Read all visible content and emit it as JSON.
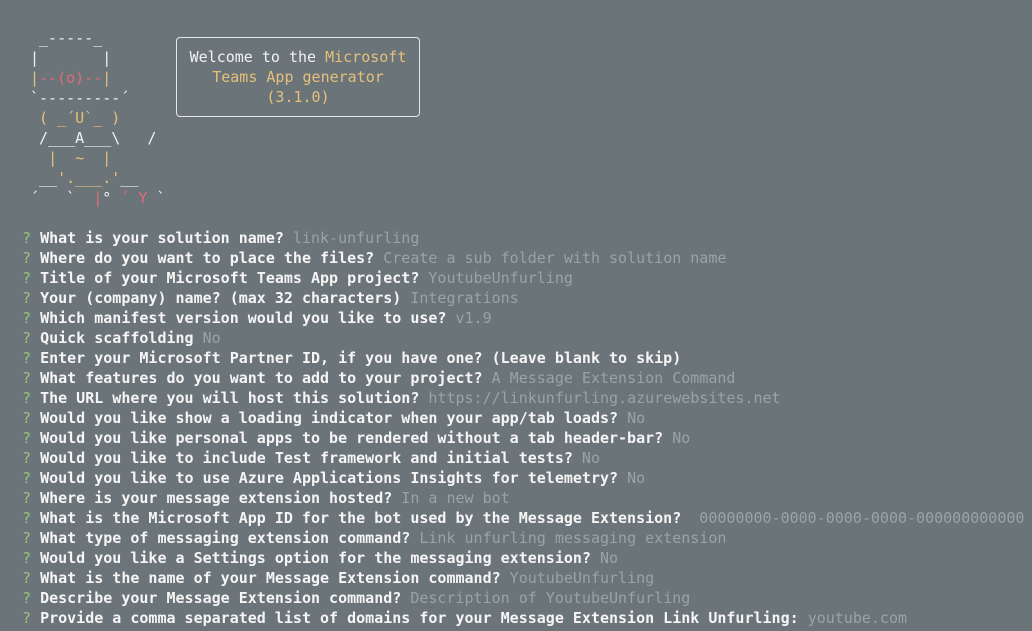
{
  "art": {
    "l1": " _-----_",
    "l2a": "|       |",
    "l3a": "|",
    "l3b": "--(o)--",
    "l3c": "|",
    "l4": "`---------´",
    "l5a": " ( ",
    "l5b": "_´U`_",
    "l5c": " )",
    "l6": " /___A___\\   /",
    "l7a": "  ",
    "l7b": "|  ~  |",
    "l8a": " __",
    "l8b": "'.___.'",
    "l8c": "__",
    "l9a": "´   `  ",
    "l9b": "|",
    "l9c": "° ",
    "l9d": "´ Y",
    "l9e": " `"
  },
  "welcome": {
    "line1_prefix": "Welcome to the ",
    "line1_highlight": "Microsoft",
    "line2": "Teams App generator",
    "line3": "(3.1.0)"
  },
  "prompts": [
    {
      "q": "What is your solution name?",
      "a": "link-unfurling"
    },
    {
      "q": "Where do you want to place the files?",
      "a": "Create a sub folder with solution name"
    },
    {
      "q": "Title of your Microsoft Teams App project?",
      "a": "YoutubeUnfurling"
    },
    {
      "q": "Your (company) name? (max 32 characters)",
      "a": "Integrations"
    },
    {
      "q": "Which manifest version would you like to use?",
      "a": "v1.9"
    },
    {
      "q": "Quick scaffolding",
      "a": "No"
    },
    {
      "q": "Enter your Microsoft Partner ID, if you have one? (Leave blank to skip)",
      "a": ""
    },
    {
      "q": "What features do you want to add to your project?",
      "a": "A Message Extension Command"
    },
    {
      "q": "The URL where you will host this solution?",
      "a": "https://linkunfurling.azurewebsites.net"
    },
    {
      "q": "Would you like show a loading indicator when your app/tab loads?",
      "a": "No"
    },
    {
      "q": "Would you like personal apps to be rendered without a tab header-bar?",
      "a": "No"
    },
    {
      "q": "Would you like to include Test framework and initial tests?",
      "a": "No"
    },
    {
      "q": "Would you like to use Azure Applications Insights for telemetry?",
      "a": "No"
    },
    {
      "q": "Where is your message extension hosted?",
      "a": "In a new bot"
    },
    {
      "q": "What is the Microsoft App ID for the bot used by the Message Extension?",
      "a": " 00000000-0000-0000-0000-000000000000"
    },
    {
      "q": "What type of messaging extension command?",
      "a": "Link unfurling messaging extension"
    },
    {
      "q": "Would you like a Settings option for the messaging extension?",
      "a": "No"
    },
    {
      "q": "What is the name of your Message Extension command?",
      "a": "YoutubeUnfurling"
    },
    {
      "q": "Describe your Message Extension command?",
      "a": "Description of YoutubeUnfurling"
    },
    {
      "q": "Provide a comma separated list of domains for your Message Extension Link Unfurling:",
      "a": "youtube.com"
    }
  ],
  "qmark": "?",
  "colors": {
    "background": "#6b7479",
    "accent_yellow": "#e5c07b",
    "accent_red": "#e06c75",
    "answer_gray": "#9aa3a6",
    "prompt_green": "#98c379"
  }
}
